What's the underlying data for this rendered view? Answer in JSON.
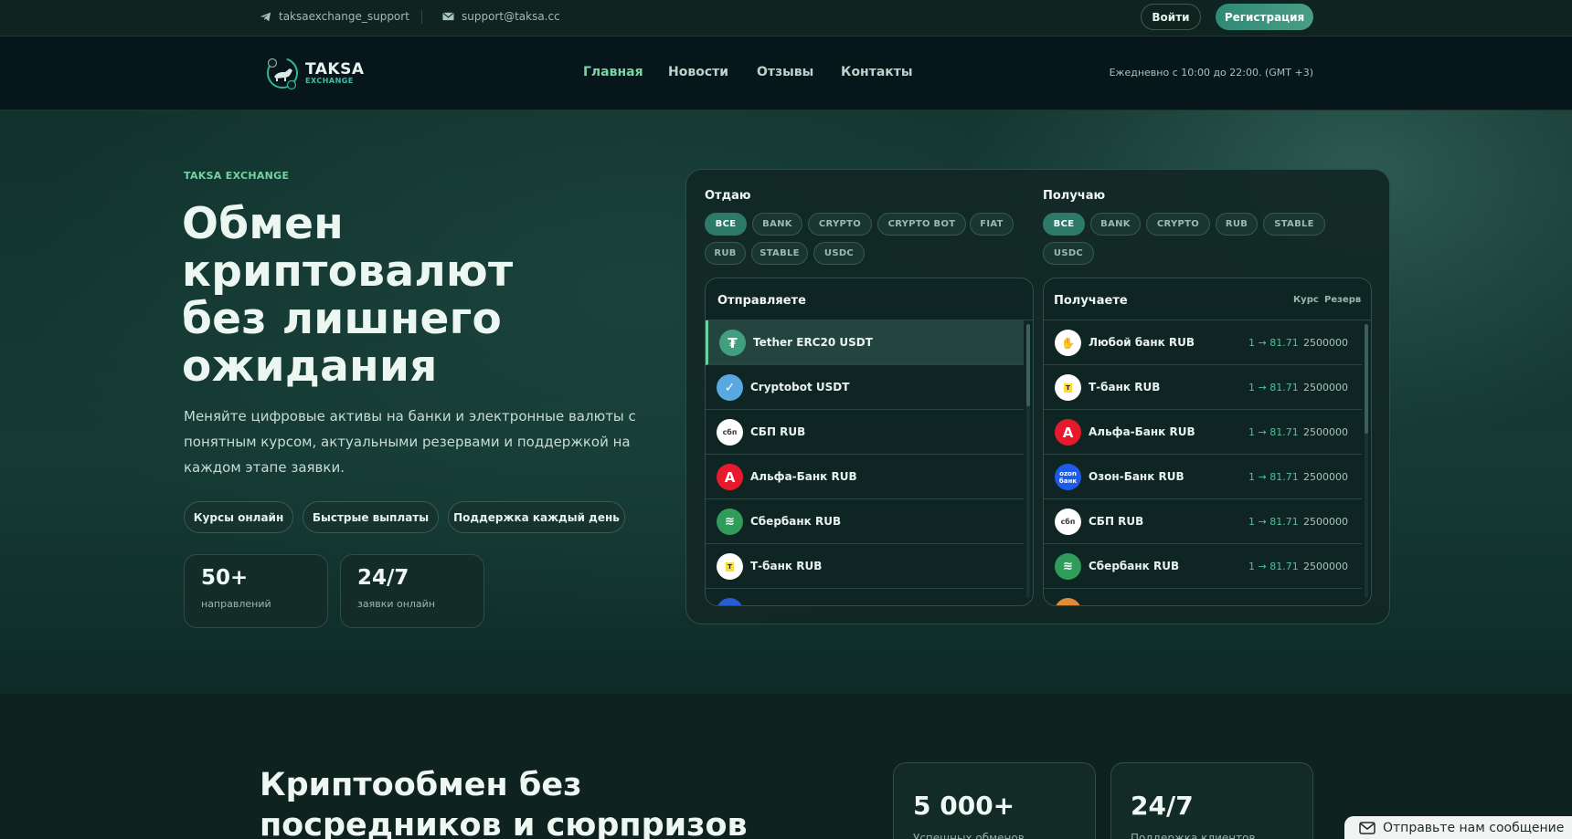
{
  "topbar": {
    "telegram": "taksaexchange_support",
    "email": "support@taksa.cc",
    "login": "Войти",
    "register": "Регистрация"
  },
  "nav": {
    "logo_main": "TAKSA",
    "logo_sub": "EXCHANGE",
    "links": [
      "Главная",
      "Новости",
      "Отзывы",
      "Контакты"
    ],
    "hours": "Ежедневно с 10:00 до 22:00. (GMT +3)"
  },
  "hero": {
    "eyebrow": "TAKSA EXCHANGE",
    "title": "Обмен криптовалют без лишнего ожидания",
    "lead": "Меняйте цифровые активы на банки и электронные валюты с понятным курсом, актуальными резервами и поддержкой на каждом этапе заявки.",
    "pills": [
      "Курсы онлайн",
      "Быстрые выплаты",
      "Поддержка каждый день"
    ],
    "stats": [
      {
        "value": "50+",
        "label": "направлений"
      },
      {
        "value": "24/7",
        "label": "заявки онлайн"
      }
    ]
  },
  "exchange": {
    "give_title": "Отдаю",
    "get_title": "Получаю",
    "give_filters": [
      "ВСЕ",
      "BANK",
      "CRYPTO",
      "CRYPTO BOT",
      "FIAT",
      "RUB",
      "STABLE",
      "USDC"
    ],
    "get_filters": [
      "ВСЕ",
      "BANK",
      "CRYPTO",
      "RUB",
      "STABLE",
      "USDC"
    ],
    "send_list": {
      "title": "Отправляете",
      "items": [
        "Tether ERC20 USDT",
        "Cryptobot USDT",
        "СБП RUB",
        "Альфа-Банк RUB",
        "Сбербанк RUB",
        "Т-банк RUB"
      ]
    },
    "receive_list": {
      "title": "Получаете",
      "rate_header": "Курс",
      "reserve_header": "Резерв",
      "items": [
        {
          "name": "Любой банк RUB",
          "rate": "1 → 81.71",
          "reserve": "2500000"
        },
        {
          "name": "Т-банк RUB",
          "rate": "1 → 81.71",
          "reserve": "2500000"
        },
        {
          "name": "Альфа-Банк RUB",
          "rate": "1 → 81.71",
          "reserve": "2500000"
        },
        {
          "name": "Озон-Банк RUB",
          "rate": "1 → 81.71",
          "reserve": "2500000"
        },
        {
          "name": "СБП RUB",
          "rate": "1 → 81.71",
          "reserve": "2500000"
        },
        {
          "name": "Сбербанк RUB",
          "rate": "1 → 81.71",
          "reserve": "2500000"
        }
      ]
    }
  },
  "section2": {
    "title": "Криптообмен без посредников и сюрпризов",
    "cards": [
      {
        "value": "5 000+",
        "label": "Успешных обменов"
      },
      {
        "value": "24/7",
        "label": "Поддержка клиентов"
      }
    ]
  },
  "chat": {
    "label": "Отправьте нам сообщение"
  },
  "colors": {
    "accent": "#2e7a69",
    "green_text": "#72d3a0",
    "rate": "#4fc09b"
  }
}
